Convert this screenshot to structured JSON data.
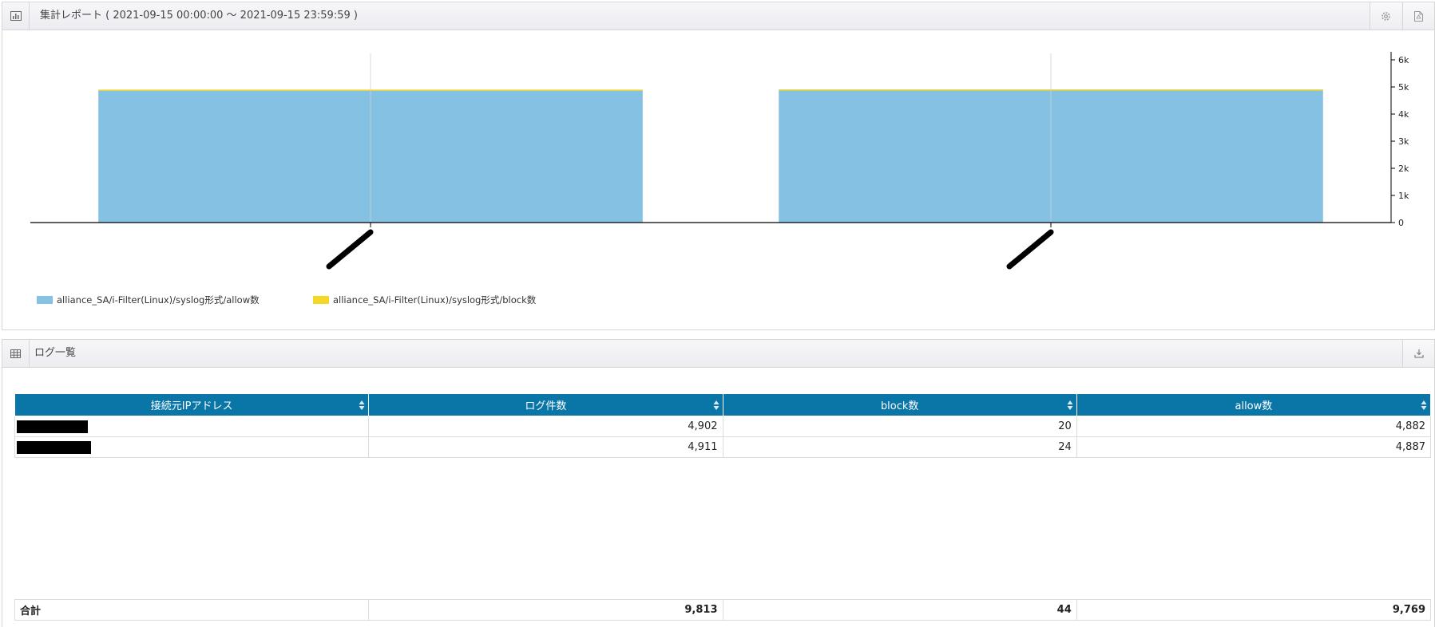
{
  "report": {
    "title": "集計レポート ( 2021-09-15 00:00:00 〜 2021-09-15 23:59:59 )",
    "icons": {
      "left": "bar-chart-icon",
      "settings": "gear-icon",
      "export": "pdf-icon"
    }
  },
  "chart_data": {
    "type": "bar",
    "stacked": true,
    "categories": [
      "",
      ""
    ],
    "series": [
      {
        "name": "alliance_SA/i-Filter(Linux)/syslog形式/allow数",
        "color": "#85c1e2",
        "values": [
          4882,
          4887
        ]
      },
      {
        "name": "alliance_SA/i-Filter(Linux)/syslog形式/block数",
        "color": "#f5d728",
        "values": [
          20,
          24
        ]
      }
    ],
    "ylim": [
      0,
      6000
    ],
    "yticks": [
      {
        "value": 0,
        "label": "0"
      },
      {
        "value": 1000,
        "label": "1k"
      },
      {
        "value": 2000,
        "label": "2k"
      },
      {
        "value": 3000,
        "label": "3k"
      },
      {
        "value": 4000,
        "label": "4k"
      },
      {
        "value": 5000,
        "label": "5k"
      },
      {
        "value": 6000,
        "label": "6k"
      }
    ],
    "y_axis_position": "right",
    "x_labels_redacted": true,
    "legend_position": "bottom-left"
  },
  "log": {
    "title": "ログ一覧",
    "icons": {
      "left": "table-icon",
      "download": "download-icon"
    },
    "columns": [
      "接続元IPアドレス",
      "ログ件数",
      "block数",
      "allow数"
    ],
    "rows": [
      {
        "ip_redacted": true,
        "log_count": "4,902",
        "block": "20",
        "allow": "4,882"
      },
      {
        "ip_redacted": true,
        "log_count": "4,911",
        "block": "24",
        "allow": "4,887"
      }
    ],
    "total": {
      "label": "合計",
      "log_count": "9,813",
      "block": "44",
      "allow": "9,769"
    }
  }
}
